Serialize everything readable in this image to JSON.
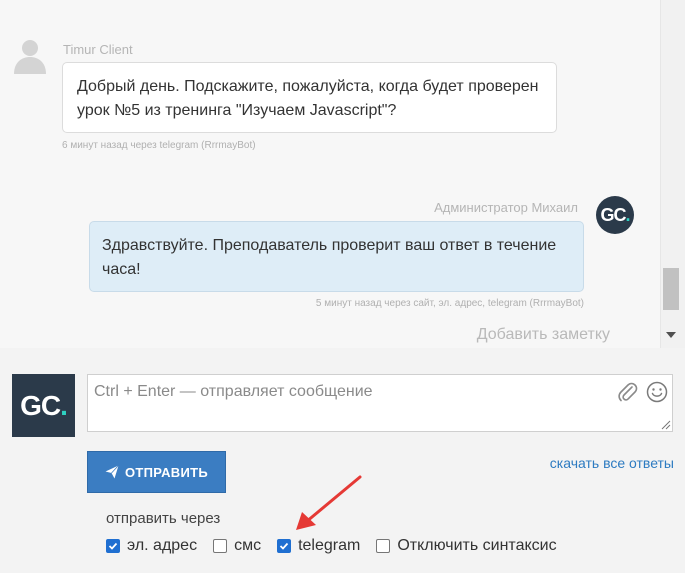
{
  "thread": {
    "client": {
      "name": "Timur Client",
      "message": "Добрый день. Подскажите, пожалуйста, когда будет проверен урок №5 из тренинга \"Изучаем Javascript\"?",
      "meta": "6 минут назад через telegram (RrrmayBot)"
    },
    "admin": {
      "name": "Администратор Михаил",
      "message": "Здравствуйте. Преподаватель проверит ваш ответ в течение часа!",
      "meta": "5 минут назад через сайт, эл. адрес, telegram (RrrmayBot)"
    },
    "add_note_label": "Добавить заметку"
  },
  "logo": {
    "text": "GC",
    "dot": ".",
    "accent": "#2fd1c2",
    "bg": "#2b3a4a"
  },
  "composer": {
    "placeholder": "Ctrl + Enter — отправляет сообщение",
    "send_label": "ОТПРАВИТЬ",
    "download_link": "скачать все ответы",
    "send_via_label": "отправить через",
    "options": [
      {
        "label": "эл. адрес",
        "checked": true
      },
      {
        "label": "смс",
        "checked": false
      },
      {
        "label": "telegram",
        "checked": true
      },
      {
        "label": "Отключить синтаксис",
        "checked": false
      }
    ]
  },
  "colors": {
    "primary": "#3b7dc2",
    "link": "#2d7bc1",
    "outgoing_bubble": "#deedf7",
    "annotation_arrow": "#e53935"
  }
}
